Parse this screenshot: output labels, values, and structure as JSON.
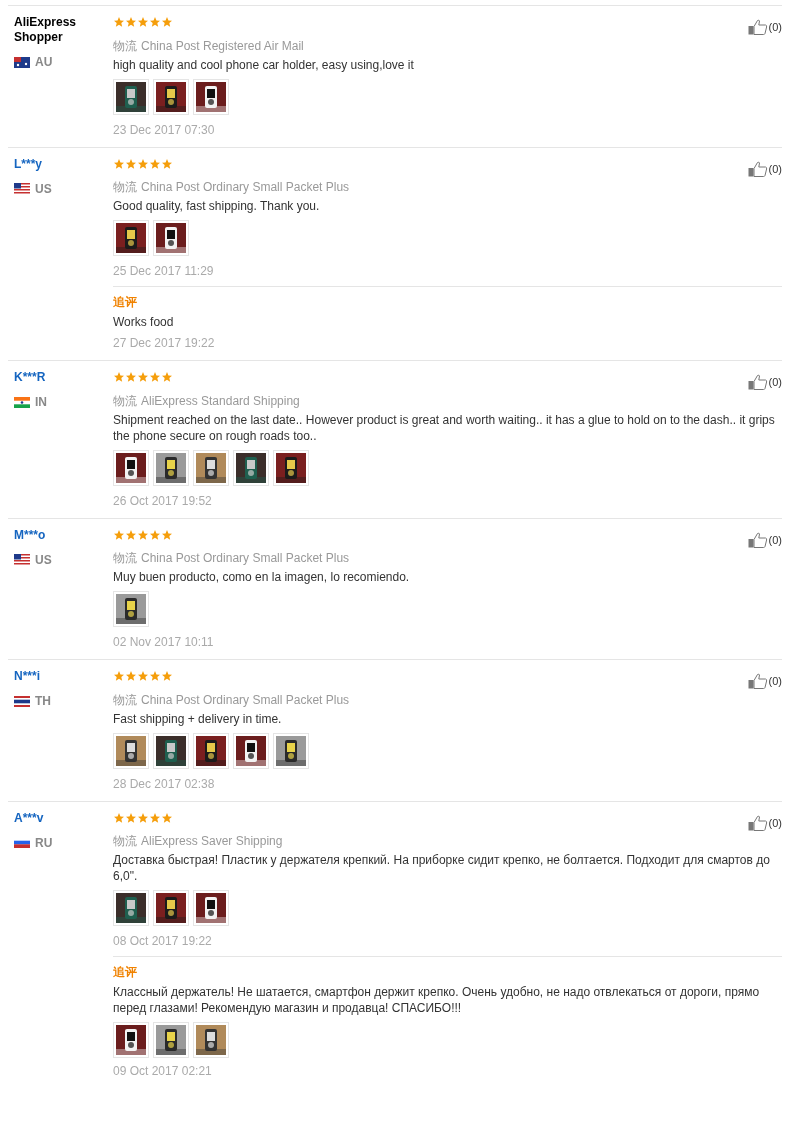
{
  "reviews": [
    {
      "name": "AliExpress Shopper",
      "link": false,
      "flag": {
        "kind": "au"
      },
      "country": "AU",
      "stars": 5,
      "logistics_label": "物流",
      "shipping": "China Post Registered Air Mail",
      "text": "high quality and cool phone car holder, easy using,love it",
      "photos": [
        {
          "kind": "picture"
        },
        {
          "kind": "picture"
        },
        {
          "kind": "picture"
        }
      ],
      "date": "23 Dec 2017 07:30",
      "likes": "(0)"
    },
    {
      "name": "L***y",
      "link": true,
      "flag": {
        "kind": "us"
      },
      "country": "US",
      "stars": 5,
      "logistics_label": "物流",
      "shipping": "China Post Ordinary Small Packet Plus",
      "text": "Good quality, fast shipping. Thank you.",
      "photos": [
        {
          "kind": "picture"
        },
        {
          "kind": "picture"
        }
      ],
      "date": "25 Dec 2017 11:29",
      "likes": "(0)",
      "followup": {
        "label": "追评",
        "text": "Works food",
        "date": "27 Dec 2017 19:22"
      }
    },
    {
      "name": "K***R",
      "link": true,
      "flag": {
        "kind": "in"
      },
      "country": "IN",
      "stars": 5,
      "logistics_label": "物流",
      "shipping": "AliExpress Standard Shipping",
      "text": "Shipment reached on the last date.. However product is great and worth waiting.. it has a glue to hold on to the dash.. it grips the phone secure on rough roads too..",
      "photos": [
        {
          "kind": "picture"
        },
        {
          "kind": "picture"
        },
        {
          "kind": "picture"
        },
        {
          "kind": "picture"
        },
        {
          "kind": "picture"
        }
      ],
      "date": "26 Oct 2017 19:52",
      "likes": "(0)"
    },
    {
      "name": "M***o",
      "link": true,
      "flag": {
        "kind": "us"
      },
      "country": "US",
      "stars": 5,
      "logistics_label": "物流",
      "shipping": "China Post Ordinary Small Packet Plus",
      "text": "Muy buen producto, como en la imagen, lo recomiendo.",
      "photos": [
        {
          "kind": "picture"
        }
      ],
      "date": "02 Nov 2017 10:11",
      "likes": "(0)"
    },
    {
      "name": "N***i",
      "link": true,
      "flag": {
        "kind": "th"
      },
      "country": "TH",
      "stars": 5,
      "logistics_label": "物流",
      "shipping": "China Post Ordinary Small Packet Plus",
      "text": "Fast shipping + delivery in time.",
      "photos": [
        {
          "kind": "picture"
        },
        {
          "kind": "picture"
        },
        {
          "kind": "picture"
        },
        {
          "kind": "picture"
        },
        {
          "kind": "picture"
        }
      ],
      "date": "28 Dec 2017 02:38",
      "likes": "(0)"
    },
    {
      "name": "A***v",
      "link": true,
      "flag": {
        "kind": "ru"
      },
      "country": "RU",
      "stars": 5,
      "logistics_label": "物流",
      "shipping": "AliExpress Saver Shipping",
      "text": "Доставка быстрая! Пластик у держателя крепкий. На приборке сидит крепко, не болтается. Подходит для смартов до 6,0\".",
      "photos": [
        {
          "kind": "picture"
        },
        {
          "kind": "picture"
        },
        {
          "kind": "picture"
        }
      ],
      "date": "08 Oct 2017 19:22",
      "likes": "(0)",
      "followup": {
        "label": "追评",
        "text": "Классный держатель! Не шатается, смартфон держит крепко. Очень удобно, не надо отвлекаться от дороги, прямо перед глазами! Рекомендую магазин и продавца! СПАСИБО!!!",
        "photos": [
          {
            "kind": "picture"
          },
          {
            "kind": "picture"
          },
          {
            "kind": "picture"
          }
        ],
        "date": "09 Oct 2017 02:21"
      }
    }
  ]
}
